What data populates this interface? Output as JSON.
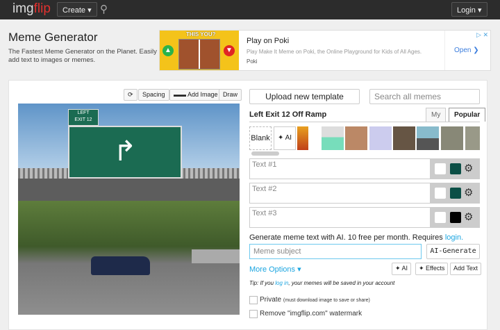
{
  "nav": {
    "logo_a": "img",
    "logo_b": "flip",
    "create": "Create ▾",
    "login": "Login ▾"
  },
  "header": {
    "title": "Meme Generator",
    "subtitle": "The Fastest Meme Generator on the Planet. Easily add text to images or memes."
  },
  "ad": {
    "image_title": "THIS YOU?",
    "title": "Play on Poki",
    "desc": "Play Make It Meme on Poki, the Online Playground for Kids of All Ages.",
    "brand": "Poki",
    "cta": "Open ❯",
    "badge": "▷ ✕"
  },
  "canvas_toolbar": {
    "rotate": "⟳",
    "spacing": "Spacing",
    "add_image": "Add Image",
    "draw": "Draw"
  },
  "meme": {
    "sign_tab": "LEFT\nEXIT 12",
    "arrow": "↱"
  },
  "right": {
    "upload": "Upload new template",
    "search_placeholder": "Search all memes",
    "template_name": "Left Exit 12 Off Ramp",
    "tab_my": "My",
    "tab_popular": "Popular",
    "blank": "Blank",
    "ai": "✦ AI"
  },
  "text_boxes": [
    {
      "placeholder": "Text #1",
      "color": "#ffffff",
      "outline": "#0b4f46"
    },
    {
      "placeholder": "Text #2",
      "color": "#ffffff",
      "outline": "#0b4f46"
    },
    {
      "placeholder": "Text #3",
      "color": "#ffffff",
      "outline": "#000000"
    }
  ],
  "ai": {
    "prompt": "Generate meme text with AI. 10 free per month. Requires ",
    "login": "login.",
    "subject_placeholder": "Meme subject",
    "generate": "AI-Generate"
  },
  "options": {
    "more": "More Options ▾",
    "ai": "✦ AI",
    "effects": "✦ Effects",
    "add_text": "Add Text"
  },
  "tip": {
    "a": "Tip: If you ",
    "link": "log in",
    "b": ", your memes will be saved in your account"
  },
  "checkboxes": {
    "private": "Private",
    "private_note": "(must download image to save or share)",
    "watermark": "Remove \"imgflip.com\" watermark"
  }
}
